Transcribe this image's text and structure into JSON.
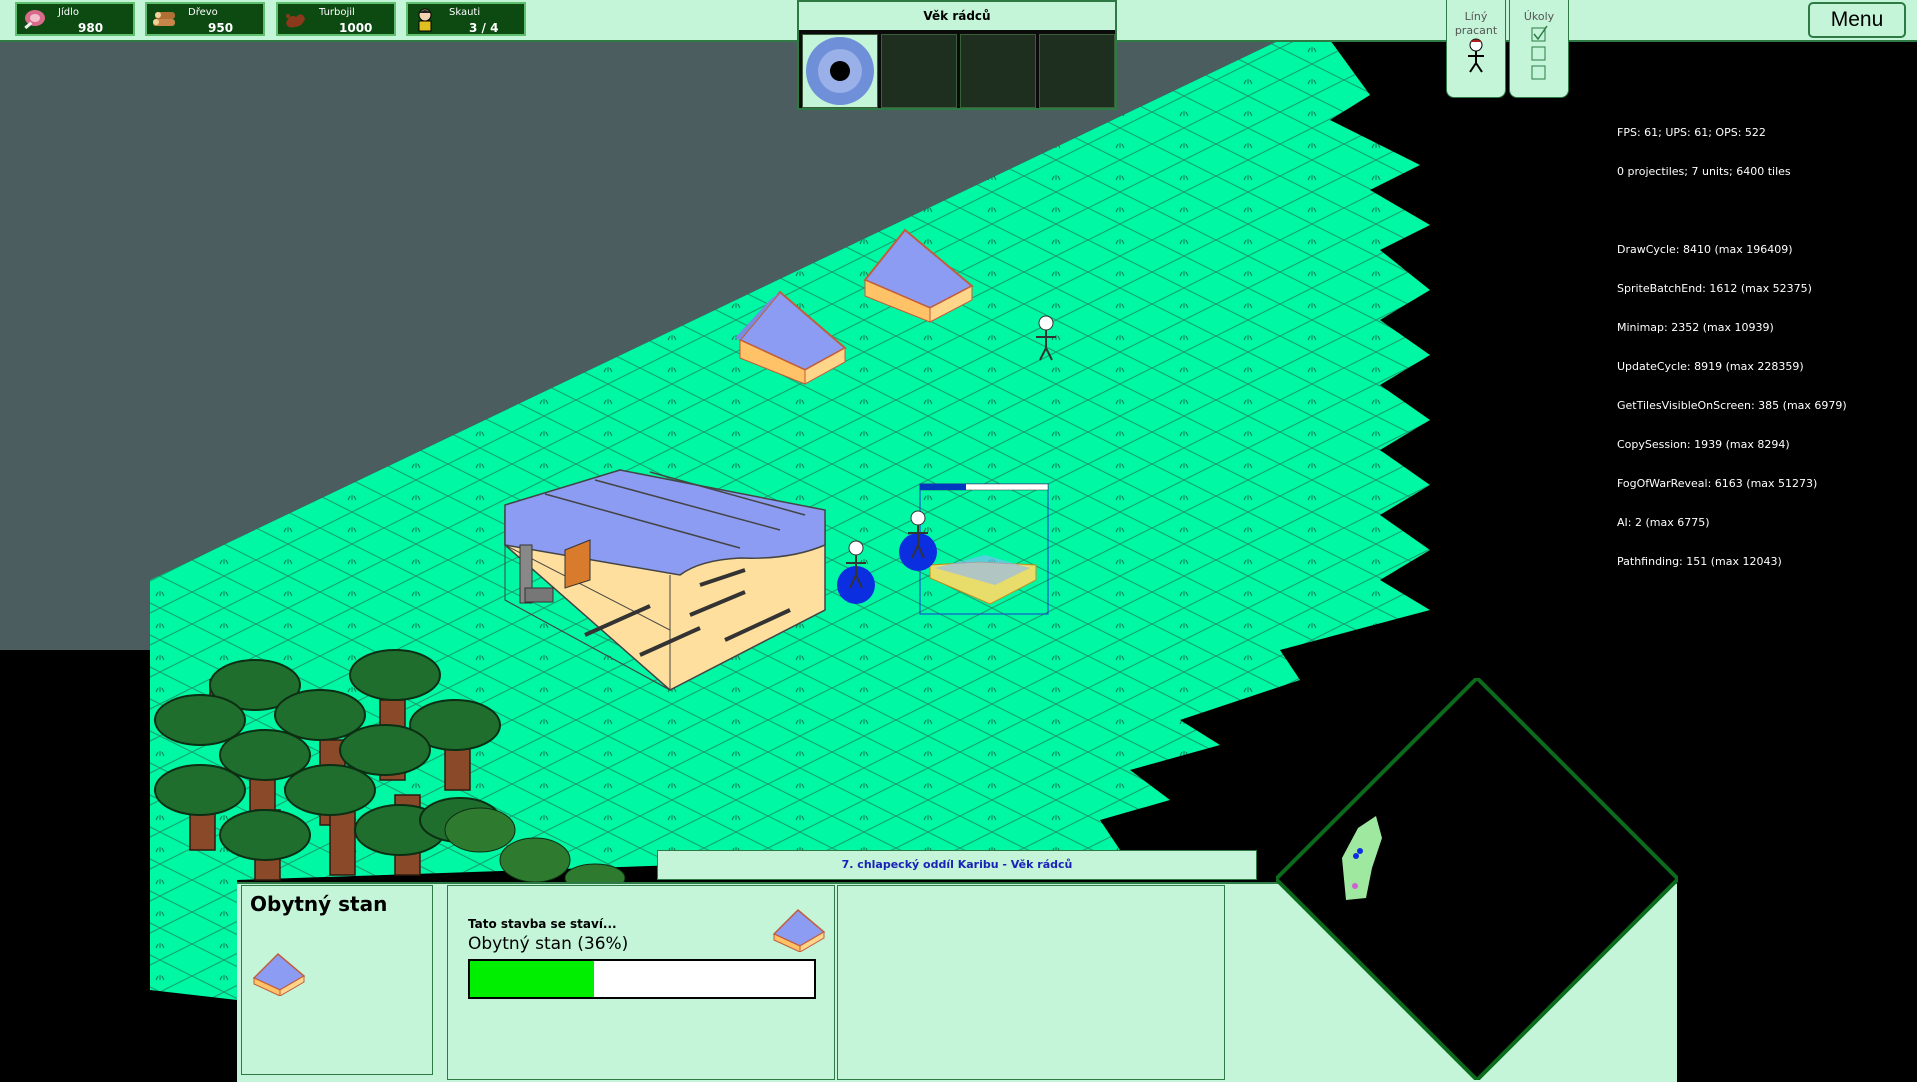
{
  "resources": [
    {
      "name": "Jídlo",
      "value": "980",
      "icon": "meat-icon"
    },
    {
      "name": "Dřevo",
      "value": "950",
      "icon": "wood-icon"
    },
    {
      "name": "Turbojil",
      "value": "1000",
      "icon": "turbojil-icon"
    },
    {
      "name": "Skauti",
      "value": "3 / 4",
      "icon": "scout-icon"
    }
  ],
  "age_panel": {
    "title": "Věk rádců"
  },
  "buttons": {
    "lazy_worker": "Líný pracant",
    "tasks": "Úkoly",
    "menu": "Menu"
  },
  "debug": {
    "lines": [
      "FPS: 61; UPS: 61; OPS: 522",
      "0 projectiles; 7 units; 6400 tiles",
      "",
      "DrawCycle: 8410 (max 196409)",
      "SpriteBatchEnd: 1612 (max 52375)",
      "Minimap: 2352 (max 10939)",
      "UpdateCycle: 8919 (max 228359)",
      "GetTilesVisibleOnScreen: 385 (max 6979)",
      "CopySession: 1939 (max 8294)",
      "FogOfWarReveal: 6163 (max 51273)",
      "AI: 2 (max 6775)",
      "Pathfinding: 151 (max 12043)"
    ]
  },
  "status_bar": "7. chlapecký oddíl Karibu - Věk rádců",
  "selection": {
    "title": "Obytný stan",
    "building_label": "Tato stavba se staví...",
    "building_name": "Obytný stan (36%)",
    "progress": 0.36
  },
  "colors": {
    "grass": "#00f7a4",
    "grid_line": "#1a9e6a",
    "panel_bg": "#c4f5d8",
    "panel_border": "#2d7a44",
    "tent_roof": "#8c9cf2",
    "tent_base": "#ffc266",
    "fog": "#4c5d60",
    "selection": "#0000ff",
    "progress_fill": "#00ee00"
  }
}
